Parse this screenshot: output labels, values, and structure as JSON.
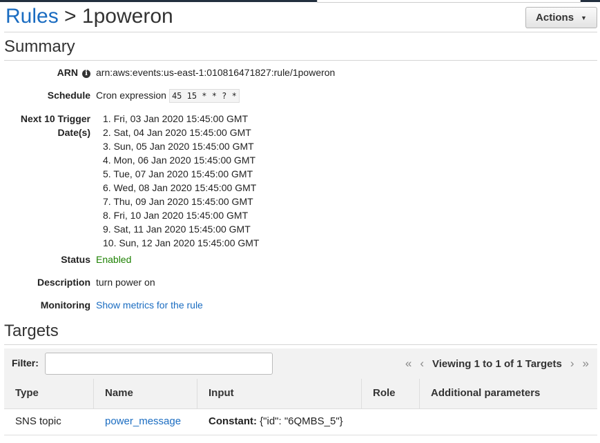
{
  "header": {
    "breadcrumb_parent": "Rules",
    "breadcrumb_sep": ">",
    "breadcrumb_current": "1poweron",
    "actions_label": "Actions"
  },
  "summary": {
    "title": "Summary",
    "arn_label": "ARN",
    "arn_value": "arn:aws:events:us-east-1:010816471827:rule/1poweron",
    "schedule_label": "Schedule",
    "schedule_prefix": "Cron expression",
    "schedule_cron": "45 15 * * ? *",
    "next_label_line1": "Next 10 Trigger",
    "next_label_line2": "Date(s)",
    "trigger_dates": [
      "1. Fri, 03 Jan 2020 15:45:00 GMT",
      "2. Sat, 04 Jan 2020 15:45:00 GMT",
      "3. Sun, 05 Jan 2020 15:45:00 GMT",
      "4. Mon, 06 Jan 2020 15:45:00 GMT",
      "5. Tue, 07 Jan 2020 15:45:00 GMT",
      "6. Wed, 08 Jan 2020 15:45:00 GMT",
      "7. Thu, 09 Jan 2020 15:45:00 GMT",
      "8. Fri, 10 Jan 2020 15:45:00 GMT",
      "9. Sat, 11 Jan 2020 15:45:00 GMT",
      "10. Sun, 12 Jan 2020 15:45:00 GMT"
    ],
    "status_label": "Status",
    "status_value": "Enabled",
    "description_label": "Description",
    "description_value": "turn power on",
    "monitoring_label": "Monitoring",
    "monitoring_link": "Show metrics for the rule"
  },
  "targets": {
    "title": "Targets",
    "filter_label": "Filter:",
    "filter_value": "",
    "pager_text": "Viewing 1 to 1 of 1 Targets",
    "columns": [
      "Type",
      "Name",
      "Input",
      "Role",
      "Additional parameters"
    ],
    "rows": [
      {
        "type": "SNS topic",
        "name": "power_message",
        "input_label": "Constant:",
        "input_value": " {\"id\": \"6QMBS_5\"}",
        "role": "",
        "additional": ""
      }
    ]
  },
  "colors": {
    "link": "#1a6cc1",
    "status_enabled": "#1d8102",
    "topbar": "#232f3e"
  },
  "icons": {
    "arn_info": "info-icon",
    "actions_dropdown": "caret-down-icon",
    "pager_first": "double-chevron-left-icon",
    "pager_prev": "chevron-left-icon",
    "pager_next": "chevron-right-icon",
    "pager_last": "double-chevron-right-icon"
  }
}
